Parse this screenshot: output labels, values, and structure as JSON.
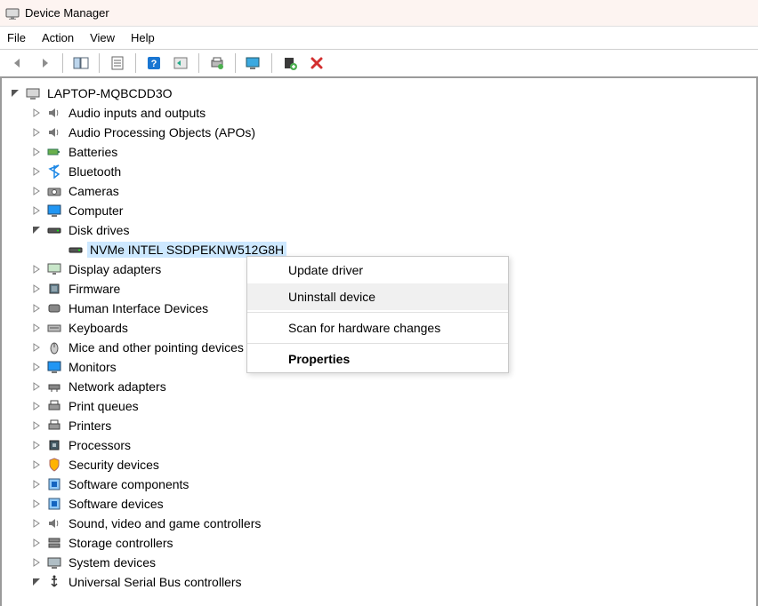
{
  "window": {
    "title": "Device Manager"
  },
  "menubar": {
    "items": [
      {
        "label": "File"
      },
      {
        "label": "Action"
      },
      {
        "label": "View"
      },
      {
        "label": "Help"
      }
    ]
  },
  "toolbar": {
    "back_label": "Back",
    "forward_label": "Forward",
    "show_hide_label": "Show/Hide Console Tree",
    "properties_label": "Properties",
    "help_label": "Help",
    "refresh_label": "Refresh",
    "print_label": "Print",
    "monitor_label": "Update Driver",
    "add_label": "Add legacy hardware",
    "uninstall_label": "Uninstall"
  },
  "tree": {
    "root": {
      "label": "LAPTOP-MQBCDD3O",
      "expanded": true
    },
    "categories": [
      {
        "label": "Audio inputs and outputs",
        "icon": "speaker"
      },
      {
        "label": "Audio Processing Objects (APOs)",
        "icon": "speaker"
      },
      {
        "label": "Batteries",
        "icon": "battery"
      },
      {
        "label": "Bluetooth",
        "icon": "bluetooth"
      },
      {
        "label": "Cameras",
        "icon": "camera"
      },
      {
        "label": "Computer",
        "icon": "monitor"
      },
      {
        "label": "Disk drives",
        "icon": "disk",
        "expanded": true
      },
      {
        "label": "Display adapters",
        "icon": "display"
      },
      {
        "label": "Firmware",
        "icon": "chip"
      },
      {
        "label": "Human Interface Devices",
        "icon": "hid"
      },
      {
        "label": "Keyboards",
        "icon": "keyboard"
      },
      {
        "label": "Mice and other pointing devices",
        "icon": "mouse"
      },
      {
        "label": "Monitors",
        "icon": "monitor"
      },
      {
        "label": "Network adapters",
        "icon": "network"
      },
      {
        "label": "Print queues",
        "icon": "printer"
      },
      {
        "label": "Printers",
        "icon": "printer"
      },
      {
        "label": "Processors",
        "icon": "cpu"
      },
      {
        "label": "Security devices",
        "icon": "security"
      },
      {
        "label": "Software components",
        "icon": "software"
      },
      {
        "label": "Software devices",
        "icon": "software"
      },
      {
        "label": "Sound, video and game controllers",
        "icon": "speaker"
      },
      {
        "label": "Storage controllers",
        "icon": "storage"
      },
      {
        "label": "System devices",
        "icon": "system"
      },
      {
        "label": "Universal Serial Bus controllers",
        "icon": "usb",
        "expanded": true
      }
    ],
    "disk_child": {
      "label": "NVMe INTEL SSDPEKNW512G8H"
    }
  },
  "context_menu": {
    "items": [
      {
        "label": "Update driver",
        "kind": "item"
      },
      {
        "label": "Uninstall device",
        "kind": "item",
        "hover": true
      },
      {
        "kind": "sep"
      },
      {
        "label": "Scan for hardware changes",
        "kind": "item"
      },
      {
        "kind": "sep"
      },
      {
        "label": "Properties",
        "kind": "item",
        "bold": true
      }
    ]
  }
}
